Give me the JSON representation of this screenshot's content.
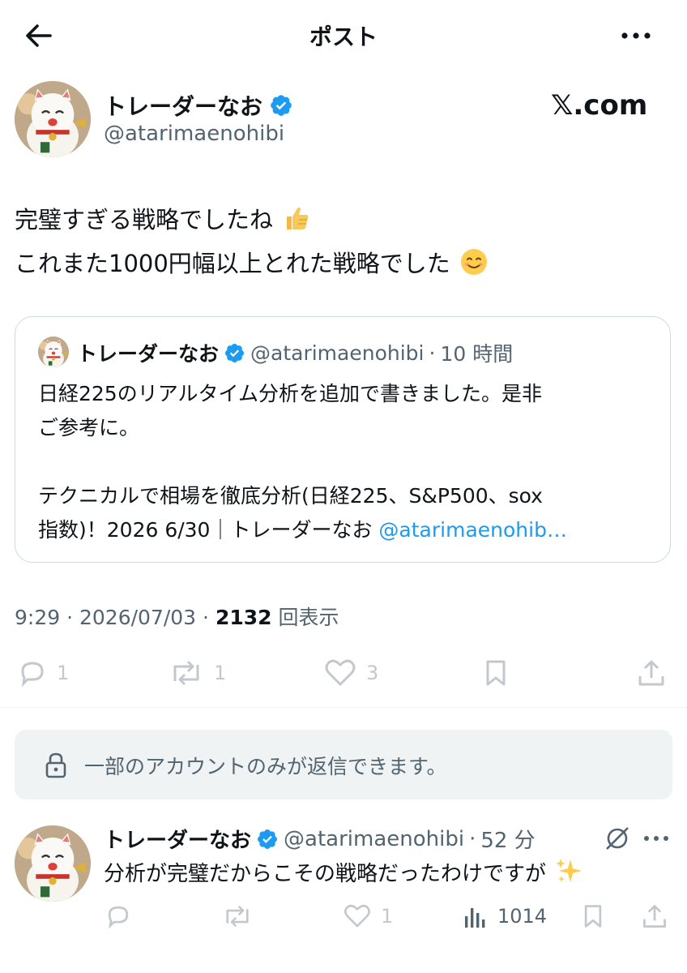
{
  "header": {
    "title": "ポスト"
  },
  "brand": {
    "label": "𝕏.com"
  },
  "main_tweet": {
    "author_name": "トレーダーなお",
    "handle": "@atarimaenohibi",
    "text_line1": "完璧すぎる戦略でしたね",
    "text_line2": "これまた1000円幅以上とれた戦略でした",
    "time": "9:29",
    "date": "2026/07/03",
    "views": "2132",
    "views_label": "回表示",
    "sep": "·",
    "counts": {
      "replies": "1",
      "reposts": "1",
      "likes": "3"
    }
  },
  "quote": {
    "author_name": "トレーダーなお",
    "handle": "@atarimaenohibi",
    "sep": "·",
    "time": "10 時間",
    "line1": "日経225のリアルタイム分析を追加で書きました。是非",
    "line2": "ご参考に。",
    "line3": "テクニカルで相場を徹底分析(日経225、S&P500、sox",
    "line4_plain": "指数)！2026 6/30｜トレーダーなお ",
    "line4_link": "@atarimaenohib…"
  },
  "reply_notice": {
    "text": "一部のアカウントのみが返信できます。"
  },
  "reply": {
    "author_name": "トレーダーなお",
    "handle": "@atarimaenohibi",
    "sep": "·",
    "time": "52 分",
    "text": "分析が完璧だからこその戦略だったわけですが",
    "counts": {
      "likes": "1",
      "views": "1014"
    }
  },
  "colors": {
    "accent": "#1d9bf0",
    "text": "#0f1419",
    "muted": "#536471",
    "border": "#cfd9de",
    "notice_bg": "#eff3f4"
  },
  "icons": [
    "back-arrow-icon",
    "more-icon",
    "verified-badge-icon",
    "thumbs-up-emoji",
    "smile-emoji",
    "reply-icon",
    "repost-icon",
    "like-icon",
    "bookmark-icon",
    "share-icon",
    "lock-icon",
    "grok-icon",
    "views-icon",
    "sparkles-emoji"
  ]
}
